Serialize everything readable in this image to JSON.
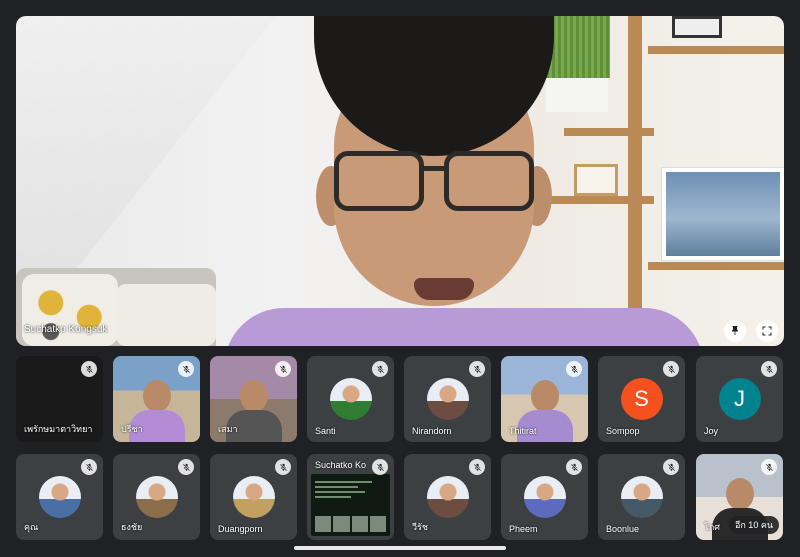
{
  "stage": {
    "speaker_name": "Suchatko Kongsuk",
    "pin_icon": "pin-icon",
    "fullscreen_icon": "fullscreen-icon"
  },
  "tiles_row1": [
    {
      "name": "เพรักษมาตาวิทยา",
      "type": "dark"
    },
    {
      "name": "ปรีชา",
      "type": "video"
    },
    {
      "name": "เสมา",
      "type": "video"
    },
    {
      "name": "Santi",
      "type": "avatar"
    },
    {
      "name": "Nirandorn",
      "type": "avatar"
    },
    {
      "name": "Thitirat",
      "type": "video"
    },
    {
      "name": "Sompop",
      "type": "initial",
      "initial": "S",
      "color": "#f4511e"
    },
    {
      "name": "Joy",
      "type": "initial",
      "initial": "J",
      "color": "#00838f"
    }
  ],
  "tiles_row2": [
    {
      "name": "คุณ",
      "type": "avatar"
    },
    {
      "name": "ธงชัย",
      "type": "avatar"
    },
    {
      "name": "Duangporn",
      "type": "avatar"
    },
    {
      "name": "Suchatko Ko",
      "type": "screen"
    },
    {
      "name": "วีรัช",
      "type": "avatar"
    },
    {
      "name": "Pheem",
      "type": "avatar"
    },
    {
      "name": "Boonlue",
      "type": "avatar"
    },
    {
      "name": "โกศ",
      "type": "video",
      "more": "อีก 10 คน"
    }
  ],
  "colors": {
    "background": "#202124",
    "tile": "#3c4043"
  }
}
